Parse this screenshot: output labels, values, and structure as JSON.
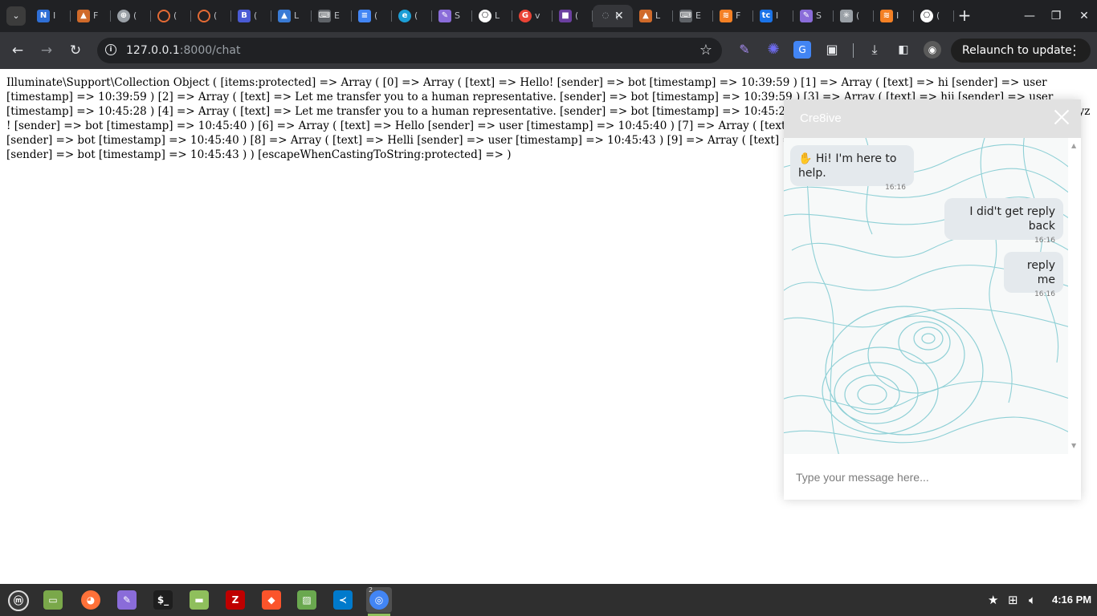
{
  "browser": {
    "tabs": [
      {
        "title": "I",
        "icon": "n-letter-icon",
        "color": "#2f6fd6"
      },
      {
        "title": "F",
        "icon": "matlab-icon",
        "color": "#d06a2a"
      },
      {
        "title": "(",
        "icon": "globe-icon",
        "color": "#9aa0a6"
      },
      {
        "title": "(",
        "icon": "loading-ring-icon",
        "color": "#e46b35"
      },
      {
        "title": "(",
        "icon": "loading-ring-icon",
        "color": "#e46b35"
      },
      {
        "title": "(",
        "icon": "b-letter-icon",
        "color": "#4a5bd4"
      },
      {
        "title": "L",
        "icon": "triangle-logo-icon",
        "color": "#3a7bd5"
      },
      {
        "title": "E",
        "icon": "keyboard-icon",
        "color": "#5f6368"
      },
      {
        "title": "(",
        "icon": "docs-icon",
        "color": "#4285f4"
      },
      {
        "title": "(",
        "icon": "edge-icon",
        "color": "#1c9ed6"
      },
      {
        "title": "S",
        "icon": "feather-icon",
        "color": "#8a6cd9"
      },
      {
        "title": "L",
        "icon": "openai-icon",
        "color": "#ffffff"
      },
      {
        "title": "v",
        "icon": "google-icon",
        "color": "#ea4335"
      },
      {
        "title": "(",
        "icon": "cube-icon",
        "color": "#6b3fa0"
      },
      {
        "title": "(",
        "icon": "active-tab-icon",
        "color": "#9aa0a6"
      },
      {
        "title": "L",
        "icon": "matlab-icon",
        "color": "#d06a2a"
      },
      {
        "title": "E",
        "icon": "keyboard-icon",
        "color": "#5f6368"
      },
      {
        "title": "F",
        "icon": "stackoverflow-icon",
        "color": "#f48024"
      },
      {
        "title": "I",
        "icon": "tc-icon",
        "color": "#1a73e8"
      },
      {
        "title": "S",
        "icon": "feather-icon",
        "color": "#8a6cd9"
      },
      {
        "title": "(",
        "icon": "gear-dots-icon",
        "color": "#9aa0a6"
      },
      {
        "title": "I",
        "icon": "stackoverflow-icon",
        "color": "#f48024"
      },
      {
        "title": "(",
        "icon": "openai-icon",
        "color": "#ffffff"
      }
    ],
    "active_tab_index": 14,
    "url_host": "127.0.0.1",
    "url_path": ":8000/chat",
    "relaunch_label": "Relaunch to update"
  },
  "page": {
    "dump_text": "Illuminate\\Support\\Collection Object ( [items:protected] => Array ( [0] => Array ( [text] => Hello! [sender] => bot [timestamp] => 10:39:59 ) [1] => Array ( [text] => hi [sender] => user [timestamp] => 10:39:59 ) [2] => Array ( [text] => Let me transfer you to a human representative. [sender] => bot [timestamp] => 10:39:59 ) [3] => Array ( [text] => hii [sender] => user [timestamp] => 10:45:28 ) [4] => Array ( [text] => Let me transfer you to a human representative. [sender] => bot [timestamp] => 10:45:28 ) [5] => Array ( [text] => Hello there my name is xyz ! [sender] => bot [timestamp] => 10:45:40 ) [6] => Array ( [text] => Hello [sender] => user [timestamp] => 10:45:40 ) [7] => Array ( [text] => Let me transfer you to a human representative. [sender] => bot [timestamp] => 10:45:40 ) [8] => Array ( [text] => Helli [sender] => user [timestamp] => 10:45:43 ) [9] => Array ( [text] => Let me transfer you to a human representative. [sender] => bot [timestamp] => 10:45:43 ) ) [escapeWhenCastingToString:protected] => )"
  },
  "chat": {
    "title": "Cre8ive",
    "messages": [
      {
        "sender": "bot",
        "text": "✋ Hi! I'm here to help.",
        "time": "16:16"
      },
      {
        "sender": "user",
        "text": "I did't get reply back",
        "time": "16:16"
      },
      {
        "sender": "user",
        "text": "reply me",
        "time": "16:16"
      }
    ],
    "input_placeholder": "Type your message here...",
    "header_color": "#e1e1e1",
    "bubble_color": "#e4e9ed",
    "pattern_color": "#8fd0d6"
  },
  "taskbar": {
    "apps": [
      {
        "name": "mint-menu-icon",
        "color": "#3a3a3a"
      },
      {
        "name": "show-desktop-icon",
        "color": "#7aa84a"
      },
      {
        "name": "firefox-icon",
        "color": "#ff7139"
      },
      {
        "name": "feather-icon",
        "color": "#8a6cd9"
      },
      {
        "name": "terminal-icon",
        "color": "#1e1e1e"
      },
      {
        "name": "files-icon",
        "color": "#8fbf5c"
      },
      {
        "name": "filezilla-icon",
        "color": "#bf0000"
      },
      {
        "name": "brave-icon",
        "color": "#fb542b"
      },
      {
        "name": "image-viewer-icon",
        "color": "#6aa84f"
      },
      {
        "name": "vscode-icon",
        "color": "#007acc"
      },
      {
        "name": "chrome-icon",
        "color": "#4285f4"
      }
    ],
    "chrome_window_count": "2",
    "clock": "4:16 PM"
  }
}
